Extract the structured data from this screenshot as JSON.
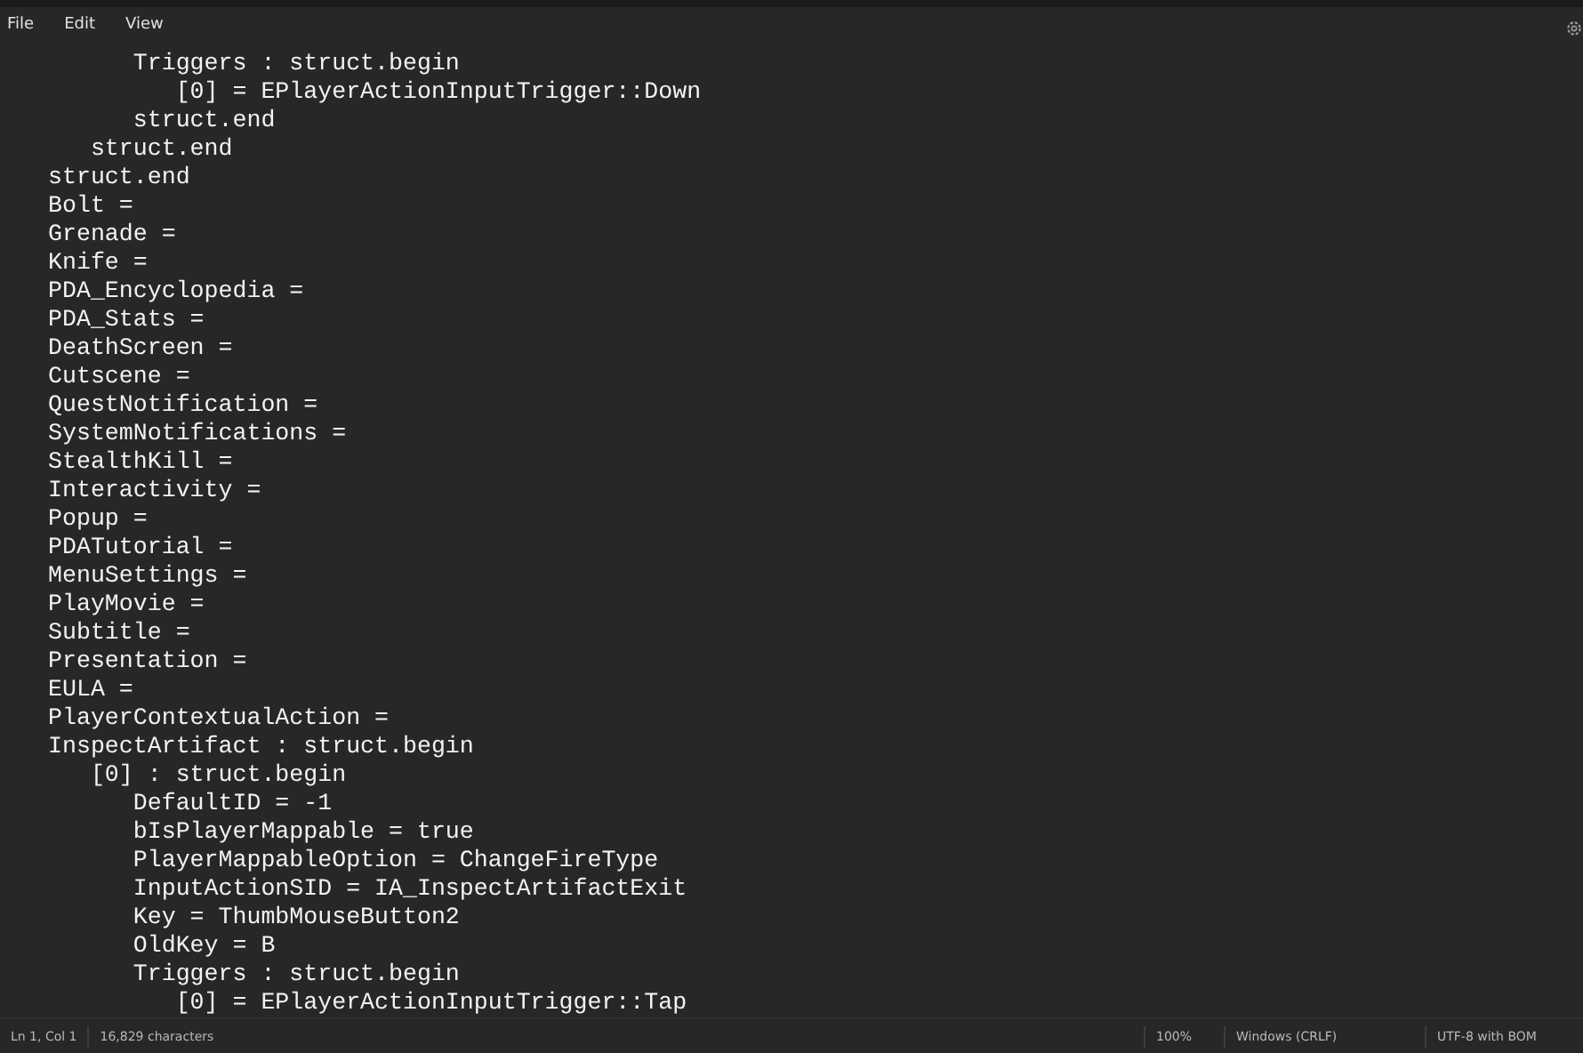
{
  "menu": [
    "File",
    "Edit",
    "View"
  ],
  "lines": [
    "      Triggers : struct.begin",
    "         [0] = EPlayerActionInputTrigger::Down",
    "      struct.end",
    "   struct.end",
    "struct.end",
    "Bolt =",
    "Grenade =",
    "Knife =",
    "PDA_Encyclopedia =",
    "PDA_Stats =",
    "DeathScreen =",
    "Cutscene =",
    "QuestNotification =",
    "SystemNotifications =",
    "StealthKill =",
    "Interactivity =",
    "Popup =",
    "PDATutorial =",
    "MenuSettings =",
    "PlayMovie =",
    "Subtitle =",
    "Presentation =",
    "EULA =",
    "PlayerContextualAction =",
    "InspectArtifact : struct.begin",
    "   [0] : struct.begin",
    "      DefaultID = -1",
    "      bIsPlayerMappable = true",
    "      PlayerMappableOption = ChangeFireType",
    "      InputActionSID = IA_InspectArtifactExit",
    "      Key = ThumbMouseButton2",
    "      OldKey = B",
    "      Triggers : struct.begin",
    "         [0] = EPlayerActionInputTrigger::Tap"
  ],
  "status_bar": {
    "position": "Ln 1, Col 1",
    "characters": "16,829 characters",
    "zoom": "100%",
    "line_ending": "Windows (CRLF)",
    "encoding": "UTF-8 with BOM"
  }
}
